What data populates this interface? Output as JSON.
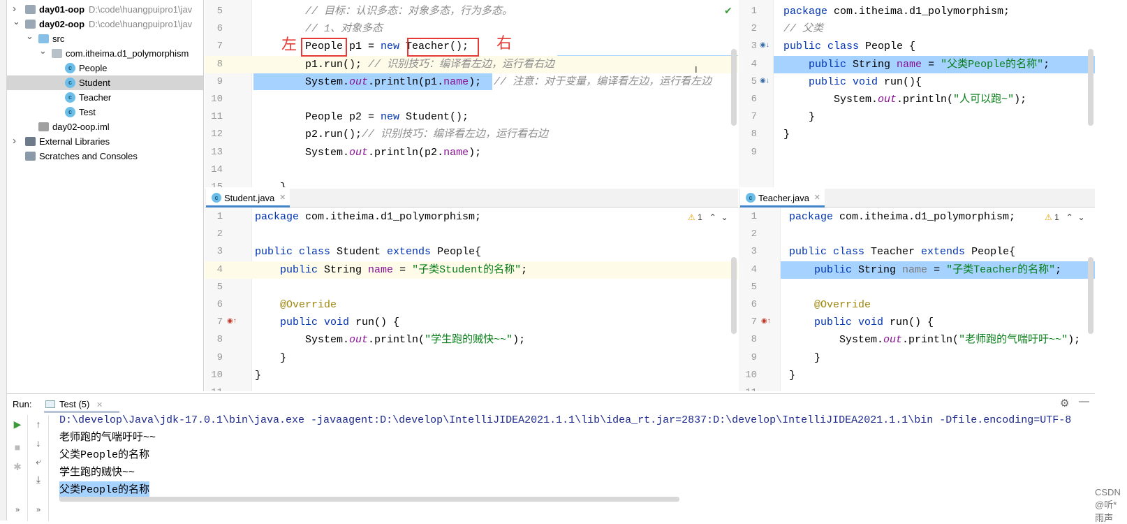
{
  "project_tree": {
    "items": [
      {
        "label": "day01-oop",
        "path": "D:\\code\\huangpuipro1\\jav",
        "kind": "module",
        "expanded": false,
        "depth": 0
      },
      {
        "label": "day02-oop",
        "path": "D:\\code\\huangpuipro1\\jav",
        "kind": "module",
        "expanded": true,
        "depth": 0
      },
      {
        "label": "src",
        "kind": "folder",
        "expanded": true,
        "depth": 1
      },
      {
        "label": "com.itheima.d1_polymorphism",
        "kind": "package",
        "expanded": true,
        "depth": 2
      },
      {
        "label": "People",
        "kind": "class",
        "depth": 3
      },
      {
        "label": "Student",
        "kind": "class",
        "depth": 3,
        "selected": true
      },
      {
        "label": "Teacher",
        "kind": "class",
        "depth": 3
      },
      {
        "label": "Test",
        "kind": "runnable-class",
        "depth": 3
      },
      {
        "label": "day02-oop.iml",
        "kind": "file",
        "depth": 1
      },
      {
        "label": "External Libraries",
        "kind": "libraries",
        "expanded": false,
        "depth": 0
      },
      {
        "label": "Scratches and Consoles",
        "kind": "scratches",
        "depth": 0
      }
    ]
  },
  "annotations": {
    "left_char": "左",
    "right_char": "右"
  },
  "editors": [
    {
      "id": "test",
      "lines": [
        {
          "n": "5",
          "t": [
            [
              "        // 目标：认识多态：对象多态，行为多态。",
              "cm"
            ]
          ]
        },
        {
          "n": "6",
          "t": [
            [
              "        // 1、对象多态",
              "cm"
            ]
          ]
        },
        {
          "n": "7",
          "t": [
            [
              "        People p1 = ",
              ""
            ],
            [
              "new",
              "kw"
            ],
            [
              " Teacher();",
              ""
            ]
          ]
        },
        {
          "n": "8",
          "hl": "current",
          "t": [
            [
              "        p1.run(); ",
              ""
            ],
            [
              "// 识别技巧：编译看左边，运行看右边",
              "cm"
            ]
          ]
        },
        {
          "n": "9",
          "t": [
            [
              "        System.",
              ""
            ],
            [
              "out",
              "fldi"
            ],
            [
              ".println(p1.",
              ""
            ],
            [
              "name",
              "fld"
            ],
            [
              ");  ",
              ""
            ],
            [
              "// 注意：对于变量，编译看左边，运行看左边",
              "cm"
            ]
          ]
        },
        {
          "n": "10",
          "t": []
        },
        {
          "n": "11",
          "t": [
            [
              "        People p2 = ",
              ""
            ],
            [
              "new",
              "kw"
            ],
            [
              " Student();",
              ""
            ]
          ]
        },
        {
          "n": "12",
          "t": [
            [
              "        p2.run();",
              ""
            ],
            [
              "// 识别技巧：编译看左边，运行看右边",
              "cm"
            ]
          ]
        },
        {
          "n": "13",
          "t": [
            [
              "        System.",
              ""
            ],
            [
              "out",
              "fldi"
            ],
            [
              ".println(p2.",
              ""
            ],
            [
              "name",
              "fld"
            ],
            [
              ");",
              ""
            ]
          ]
        },
        {
          "n": "14",
          "t": []
        },
        {
          "n": "15",
          "t": [
            [
              "    }",
              ""
            ]
          ]
        }
      ]
    },
    {
      "id": "people",
      "lines": [
        {
          "n": "1",
          "t": [
            [
              "package",
              "kw"
            ],
            [
              " com.itheima.d1_polymorphism;",
              ""
            ]
          ]
        },
        {
          "n": "2",
          "t": [
            [
              "// 父类",
              "cm"
            ]
          ]
        },
        {
          "n": "3",
          "t": [
            [
              "public class",
              "kw"
            ],
            [
              " People {",
              ""
            ]
          ]
        },
        {
          "n": "4",
          "hl": "select",
          "t": [
            [
              "    ",
              ""
            ],
            [
              "public",
              "kw"
            ],
            [
              " String ",
              ""
            ],
            [
              "name",
              "fld"
            ],
            [
              " = ",
              ""
            ],
            [
              "\"父类People的名称\"",
              "str"
            ],
            [
              ";",
              ""
            ]
          ]
        },
        {
          "n": "5",
          "t": [
            [
              "    ",
              ""
            ],
            [
              "public void",
              "kw"
            ],
            [
              " run(){",
              ""
            ]
          ]
        },
        {
          "n": "6",
          "t": [
            [
              "        System.",
              ""
            ],
            [
              "out",
              "fldi"
            ],
            [
              ".println(",
              ""
            ],
            [
              "\"人可以跑~\"",
              "str"
            ],
            [
              ");",
              ""
            ]
          ]
        },
        {
          "n": "7",
          "t": [
            [
              "    }",
              ""
            ]
          ]
        },
        {
          "n": "8",
          "t": [
            [
              "}",
              ""
            ]
          ]
        },
        {
          "n": "9",
          "t": []
        }
      ]
    },
    {
      "id": "student",
      "tab": "Student.java",
      "warnings": "1",
      "lines": [
        {
          "n": "1",
          "t": [
            [
              "package",
              "kw"
            ],
            [
              " com.itheima.d1_polymorphism;",
              ""
            ]
          ]
        },
        {
          "n": "2",
          "t": []
        },
        {
          "n": "3",
          "t": [
            [
              "public class",
              "kw"
            ],
            [
              " Student ",
              ""
            ],
            [
              "extends",
              "kw"
            ],
            [
              " People{",
              ""
            ]
          ]
        },
        {
          "n": "4",
          "hl": "current",
          "t": [
            [
              "    ",
              ""
            ],
            [
              "public",
              "kw"
            ],
            [
              " String ",
              ""
            ],
            [
              "name",
              "fld"
            ],
            [
              " = ",
              ""
            ],
            [
              "\"子类Student的名称\"",
              "str"
            ],
            [
              ";",
              ""
            ]
          ]
        },
        {
          "n": "5",
          "t": []
        },
        {
          "n": "6",
          "t": [
            [
              "    ",
              ""
            ],
            [
              "@Override",
              "ann"
            ]
          ]
        },
        {
          "n": "7",
          "t": [
            [
              "    ",
              ""
            ],
            [
              "public void",
              "kw"
            ],
            [
              " run() {",
              ""
            ]
          ]
        },
        {
          "n": "8",
          "t": [
            [
              "        System.",
              ""
            ],
            [
              "out",
              "fldi"
            ],
            [
              ".println(",
              ""
            ],
            [
              "\"学生跑的贼快~~\"",
              "str"
            ],
            [
              ");",
              ""
            ]
          ]
        },
        {
          "n": "9",
          "t": [
            [
              "    }",
              ""
            ]
          ]
        },
        {
          "n": "10",
          "t": [
            [
              "}",
              ""
            ]
          ]
        },
        {
          "n": "11",
          "t": []
        }
      ]
    },
    {
      "id": "teacher",
      "tab": "Teacher.java",
      "warnings": "1",
      "lines": [
        {
          "n": "1",
          "t": [
            [
              "package",
              "kw"
            ],
            [
              " com.itheima.d1_polymorphism;",
              ""
            ]
          ]
        },
        {
          "n": "2",
          "t": []
        },
        {
          "n": "3",
          "t": [
            [
              "public class",
              "kw"
            ],
            [
              " Teacher ",
              ""
            ],
            [
              "extends",
              "kw"
            ],
            [
              " People{",
              ""
            ]
          ]
        },
        {
          "n": "4",
          "hl": "select",
          "t": [
            [
              "    ",
              ""
            ],
            [
              "public",
              "kw"
            ],
            [
              " String ",
              ""
            ],
            [
              "name",
              "unused"
            ],
            [
              " = ",
              ""
            ],
            [
              "\"子类Teacher的名称\"",
              "str"
            ],
            [
              ";",
              ""
            ]
          ]
        },
        {
          "n": "5",
          "t": []
        },
        {
          "n": "6",
          "t": [
            [
              "    ",
              ""
            ],
            [
              "@Override",
              "ann"
            ]
          ]
        },
        {
          "n": "7",
          "t": [
            [
              "    ",
              ""
            ],
            [
              "public void",
              "kw"
            ],
            [
              " run() {",
              ""
            ]
          ]
        },
        {
          "n": "8",
          "t": [
            [
              "        System.",
              ""
            ],
            [
              "out",
              "fldi"
            ],
            [
              ".println(",
              ""
            ],
            [
              "\"老师跑的气喘吁吁~~\"",
              "str"
            ],
            [
              ");",
              ""
            ]
          ]
        },
        {
          "n": "9",
          "t": [
            [
              "    }",
              ""
            ]
          ]
        },
        {
          "n": "10",
          "t": [
            [
              "}",
              ""
            ]
          ]
        },
        {
          "n": "11",
          "t": []
        }
      ]
    }
  ],
  "run": {
    "label": "Run:",
    "tab": "Test (5)",
    "output": [
      "D:\\develop\\Java\\jdk-17.0.1\\bin\\java.exe -javaagent:D:\\develop\\IntelliJIDEA2021.1.1\\lib\\idea_rt.jar=2837:D:\\develop\\IntelliJIDEA2021.1.1\\bin -Dfile.encoding=UTF-8",
      "老师跑的气喘吁吁~~",
      "父类People的名称",
      "学生跑的贼快~~",
      "父类People的名称"
    ],
    "selected_line": 4
  },
  "watermark": "CSDN @听*雨声",
  "colors": {
    "keyword": "#0033b3",
    "string": "#067d17",
    "comment": "#8c8c8c",
    "field": "#871094",
    "selection": "#a6d2ff",
    "annotation_red": "#e53935"
  }
}
